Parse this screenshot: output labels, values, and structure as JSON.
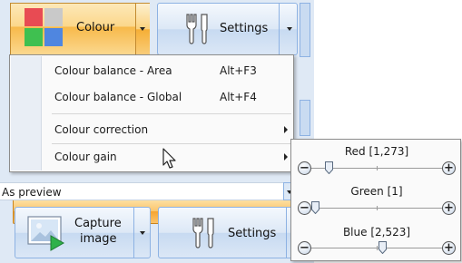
{
  "ribbon": {
    "colour_button": {
      "label": "Colour"
    },
    "settings_top": {
      "label": "Settings"
    },
    "capture_button": {
      "label_line1": "Capture",
      "label_line2": "image"
    },
    "settings_bottom": {
      "label": "Settings"
    }
  },
  "menu": {
    "items": [
      {
        "label": "Colour balance - Area",
        "shortcut": "Alt+F3"
      },
      {
        "label": "Colour balance - Global",
        "shortcut": "Alt+F4"
      },
      {
        "label": "Colour correction",
        "shortcut": ""
      },
      {
        "label": "Colour gain",
        "shortcut": ""
      }
    ],
    "highlighted_index": 3
  },
  "preview_select": {
    "value": "As preview"
  },
  "gain": {
    "sliders": [
      {
        "label": "Red [1,273]",
        "level": 0.11
      },
      {
        "label": "Green [1]",
        "level": 0.0
      },
      {
        "label": "Blue [2,523]",
        "level": 0.52
      }
    ]
  },
  "colors": {
    "menu_highlight": "#f8b040",
    "ribbon_bg": "#dfe9f5",
    "button_border": "#8db2e3"
  },
  "icons": [
    "colour-grid-icon",
    "settings-icon",
    "chevron-down-icon",
    "submenu-arrow-icon",
    "mouse-cursor-icon",
    "capture-image-icon",
    "minus-icon",
    "plus-icon",
    "slider-thumb-icon"
  ]
}
